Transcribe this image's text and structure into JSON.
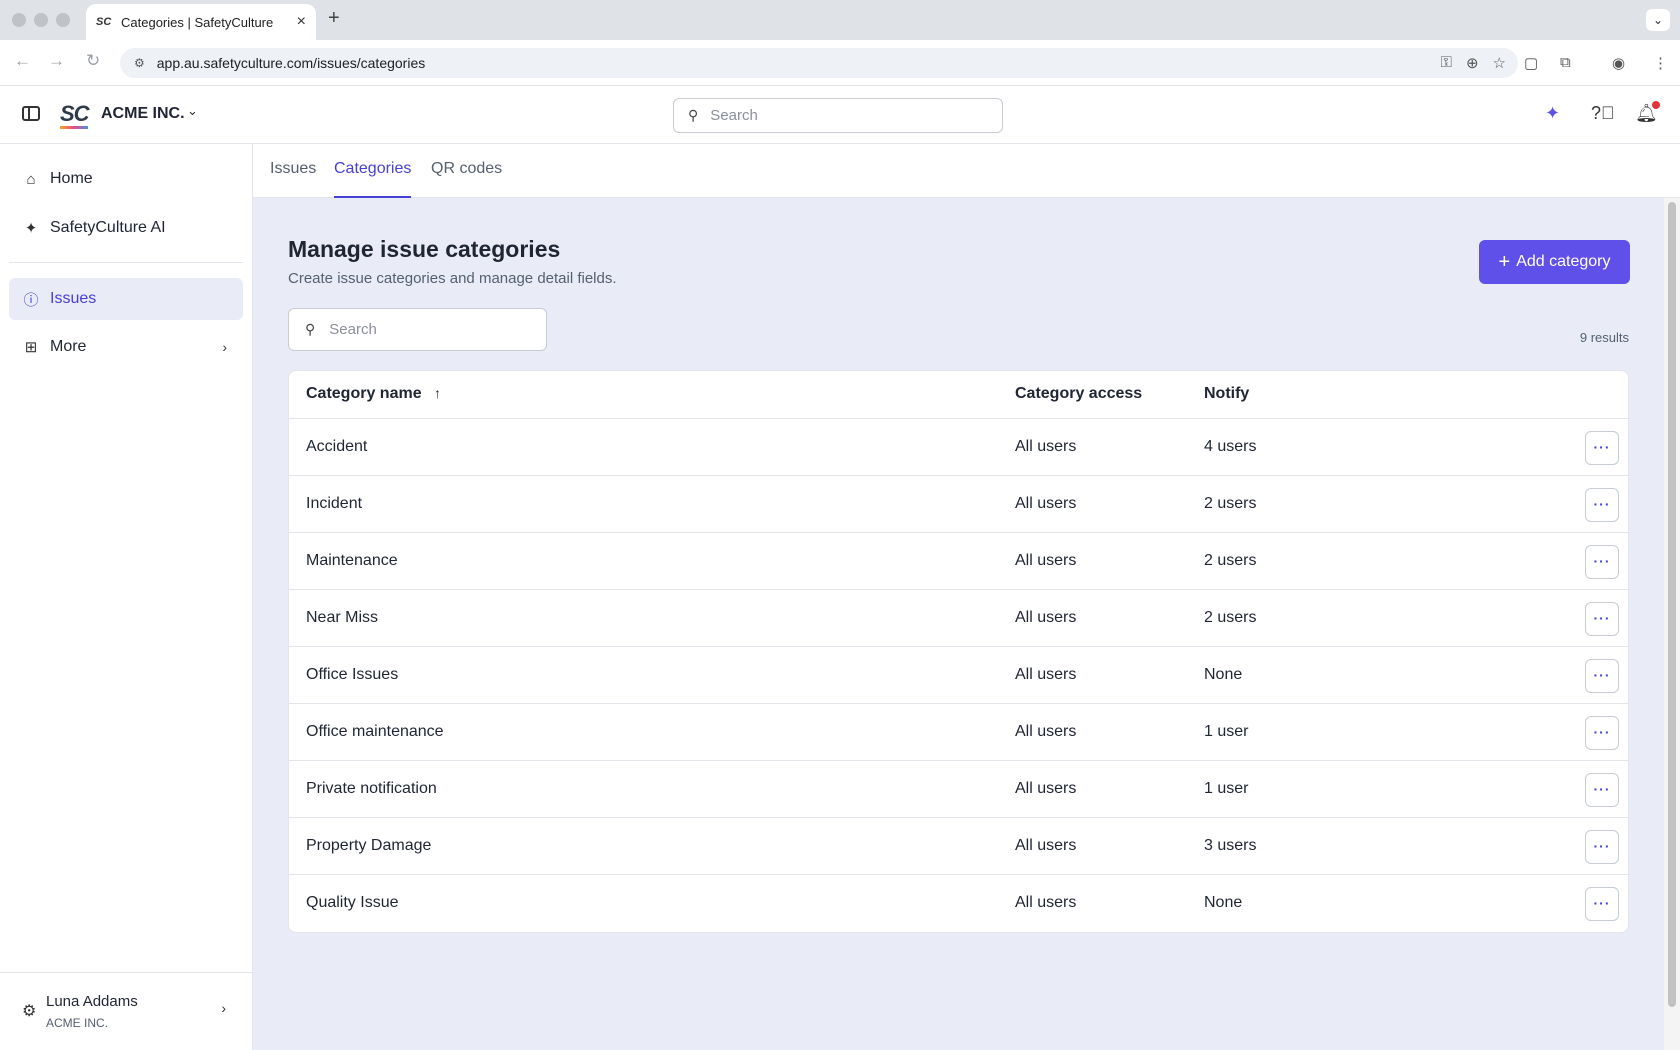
{
  "browser": {
    "tab_title": "Categories | SafetyCulture",
    "tab_favicon": "SC",
    "url": "app.au.safetyculture.com/issues/categories"
  },
  "header": {
    "logo": "SC",
    "org_name": "ACME INC.",
    "search_placeholder": "Search",
    "accent_color": "#5e50e8"
  },
  "sidebar": {
    "items": [
      {
        "label": "Home",
        "icon": "home-icon"
      },
      {
        "label": "SafetyCulture AI",
        "icon": "sparkle-icon"
      },
      {
        "label": "Issues",
        "icon": "issue-icon"
      },
      {
        "label": "More",
        "icon": "grid-icon"
      }
    ],
    "user": {
      "name": "Luna Addams",
      "org": "ACME INC."
    }
  },
  "subtabs": [
    "Issues",
    "Categories",
    "QR codes"
  ],
  "main": {
    "title": "Manage issue categories",
    "subtitle": "Create issue categories and manage detail fields.",
    "add_button": "Add category",
    "search_placeholder": "Search",
    "results": "9 results",
    "columns": [
      "Category name",
      "Category access",
      "Notify"
    ],
    "rows": [
      {
        "name": "Accident",
        "access": "All users",
        "notify": "4 users"
      },
      {
        "name": "Incident",
        "access": "All users",
        "notify": "2 users"
      },
      {
        "name": "Maintenance",
        "access": "All users",
        "notify": "2 users"
      },
      {
        "name": "Near Miss",
        "access": "All users",
        "notify": "2 users"
      },
      {
        "name": "Office Issues",
        "access": "All users",
        "notify": "None"
      },
      {
        "name": "Office maintenance",
        "access": "All users",
        "notify": "1 user"
      },
      {
        "name": "Private notification",
        "access": "All users",
        "notify": "1 user"
      },
      {
        "name": "Property Damage",
        "access": "All users",
        "notify": "3 users"
      },
      {
        "name": "Quality Issue",
        "access": "All users",
        "notify": "None"
      }
    ]
  }
}
